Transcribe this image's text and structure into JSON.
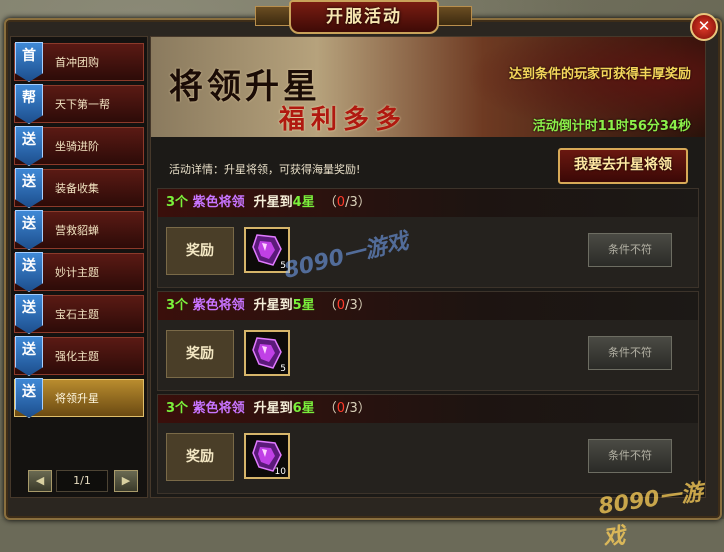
{
  "window": {
    "title": "开服活动",
    "close_glyph": "✕"
  },
  "sidebar": {
    "items": [
      {
        "badge": "首",
        "label": "首冲团购"
      },
      {
        "badge": "帮",
        "label": "天下第一帮"
      },
      {
        "badge": "送",
        "label": "坐骑进阶"
      },
      {
        "badge": "送",
        "label": "装备收集"
      },
      {
        "badge": "送",
        "label": "营救貂蝉"
      },
      {
        "badge": "送",
        "label": "妙计主题"
      },
      {
        "badge": "送",
        "label": "宝石主题"
      },
      {
        "badge": "送",
        "label": "强化主题"
      },
      {
        "badge": "送",
        "label": "将领升星"
      }
    ],
    "active_index": 8,
    "pager": {
      "prev": "◀",
      "next": "▶",
      "text": "1/1"
    }
  },
  "banner": {
    "title_line1": "将领升星",
    "title_line2": "福利多多",
    "notice": "达到条件的玩家可获得丰厚奖励",
    "countdown": "活动倒计时11时56分34秒"
  },
  "detail": "活动详情：升星将领，可获得海量奖励!",
  "go_button": "我要去升星将领",
  "tasks": [
    {
      "count": "3个",
      "grade": "紫色将领",
      "level_text": "升星到",
      "star": "4星",
      "prog_open": "（",
      "prog_cur": "0",
      "prog_rest": "/3）",
      "reward_label": "奖励",
      "reward_qty": "5",
      "cond": "条件不符"
    },
    {
      "count": "3个",
      "grade": "紫色将领",
      "level_text": "升星到",
      "star": "5星",
      "prog_open": "（",
      "prog_cur": "0",
      "prog_rest": "/3）",
      "reward_label": "奖励",
      "reward_qty": "5",
      "cond": "条件不符"
    },
    {
      "count": "3个",
      "grade": "紫色将领",
      "level_text": "升星到",
      "star": "6星",
      "prog_open": "（",
      "prog_cur": "0",
      "prog_rest": "/3）",
      "reward_label": "奖励",
      "reward_qty": "10",
      "cond": "条件不符"
    }
  ],
  "watermarks": {
    "mid": "8090一游戏",
    "corner": "8090一游戏"
  },
  "colors": {
    "accent_gold": "#d7a957",
    "progress_red": "#ff3a2a",
    "green": "#7af03b",
    "purple": "#c874ff"
  }
}
